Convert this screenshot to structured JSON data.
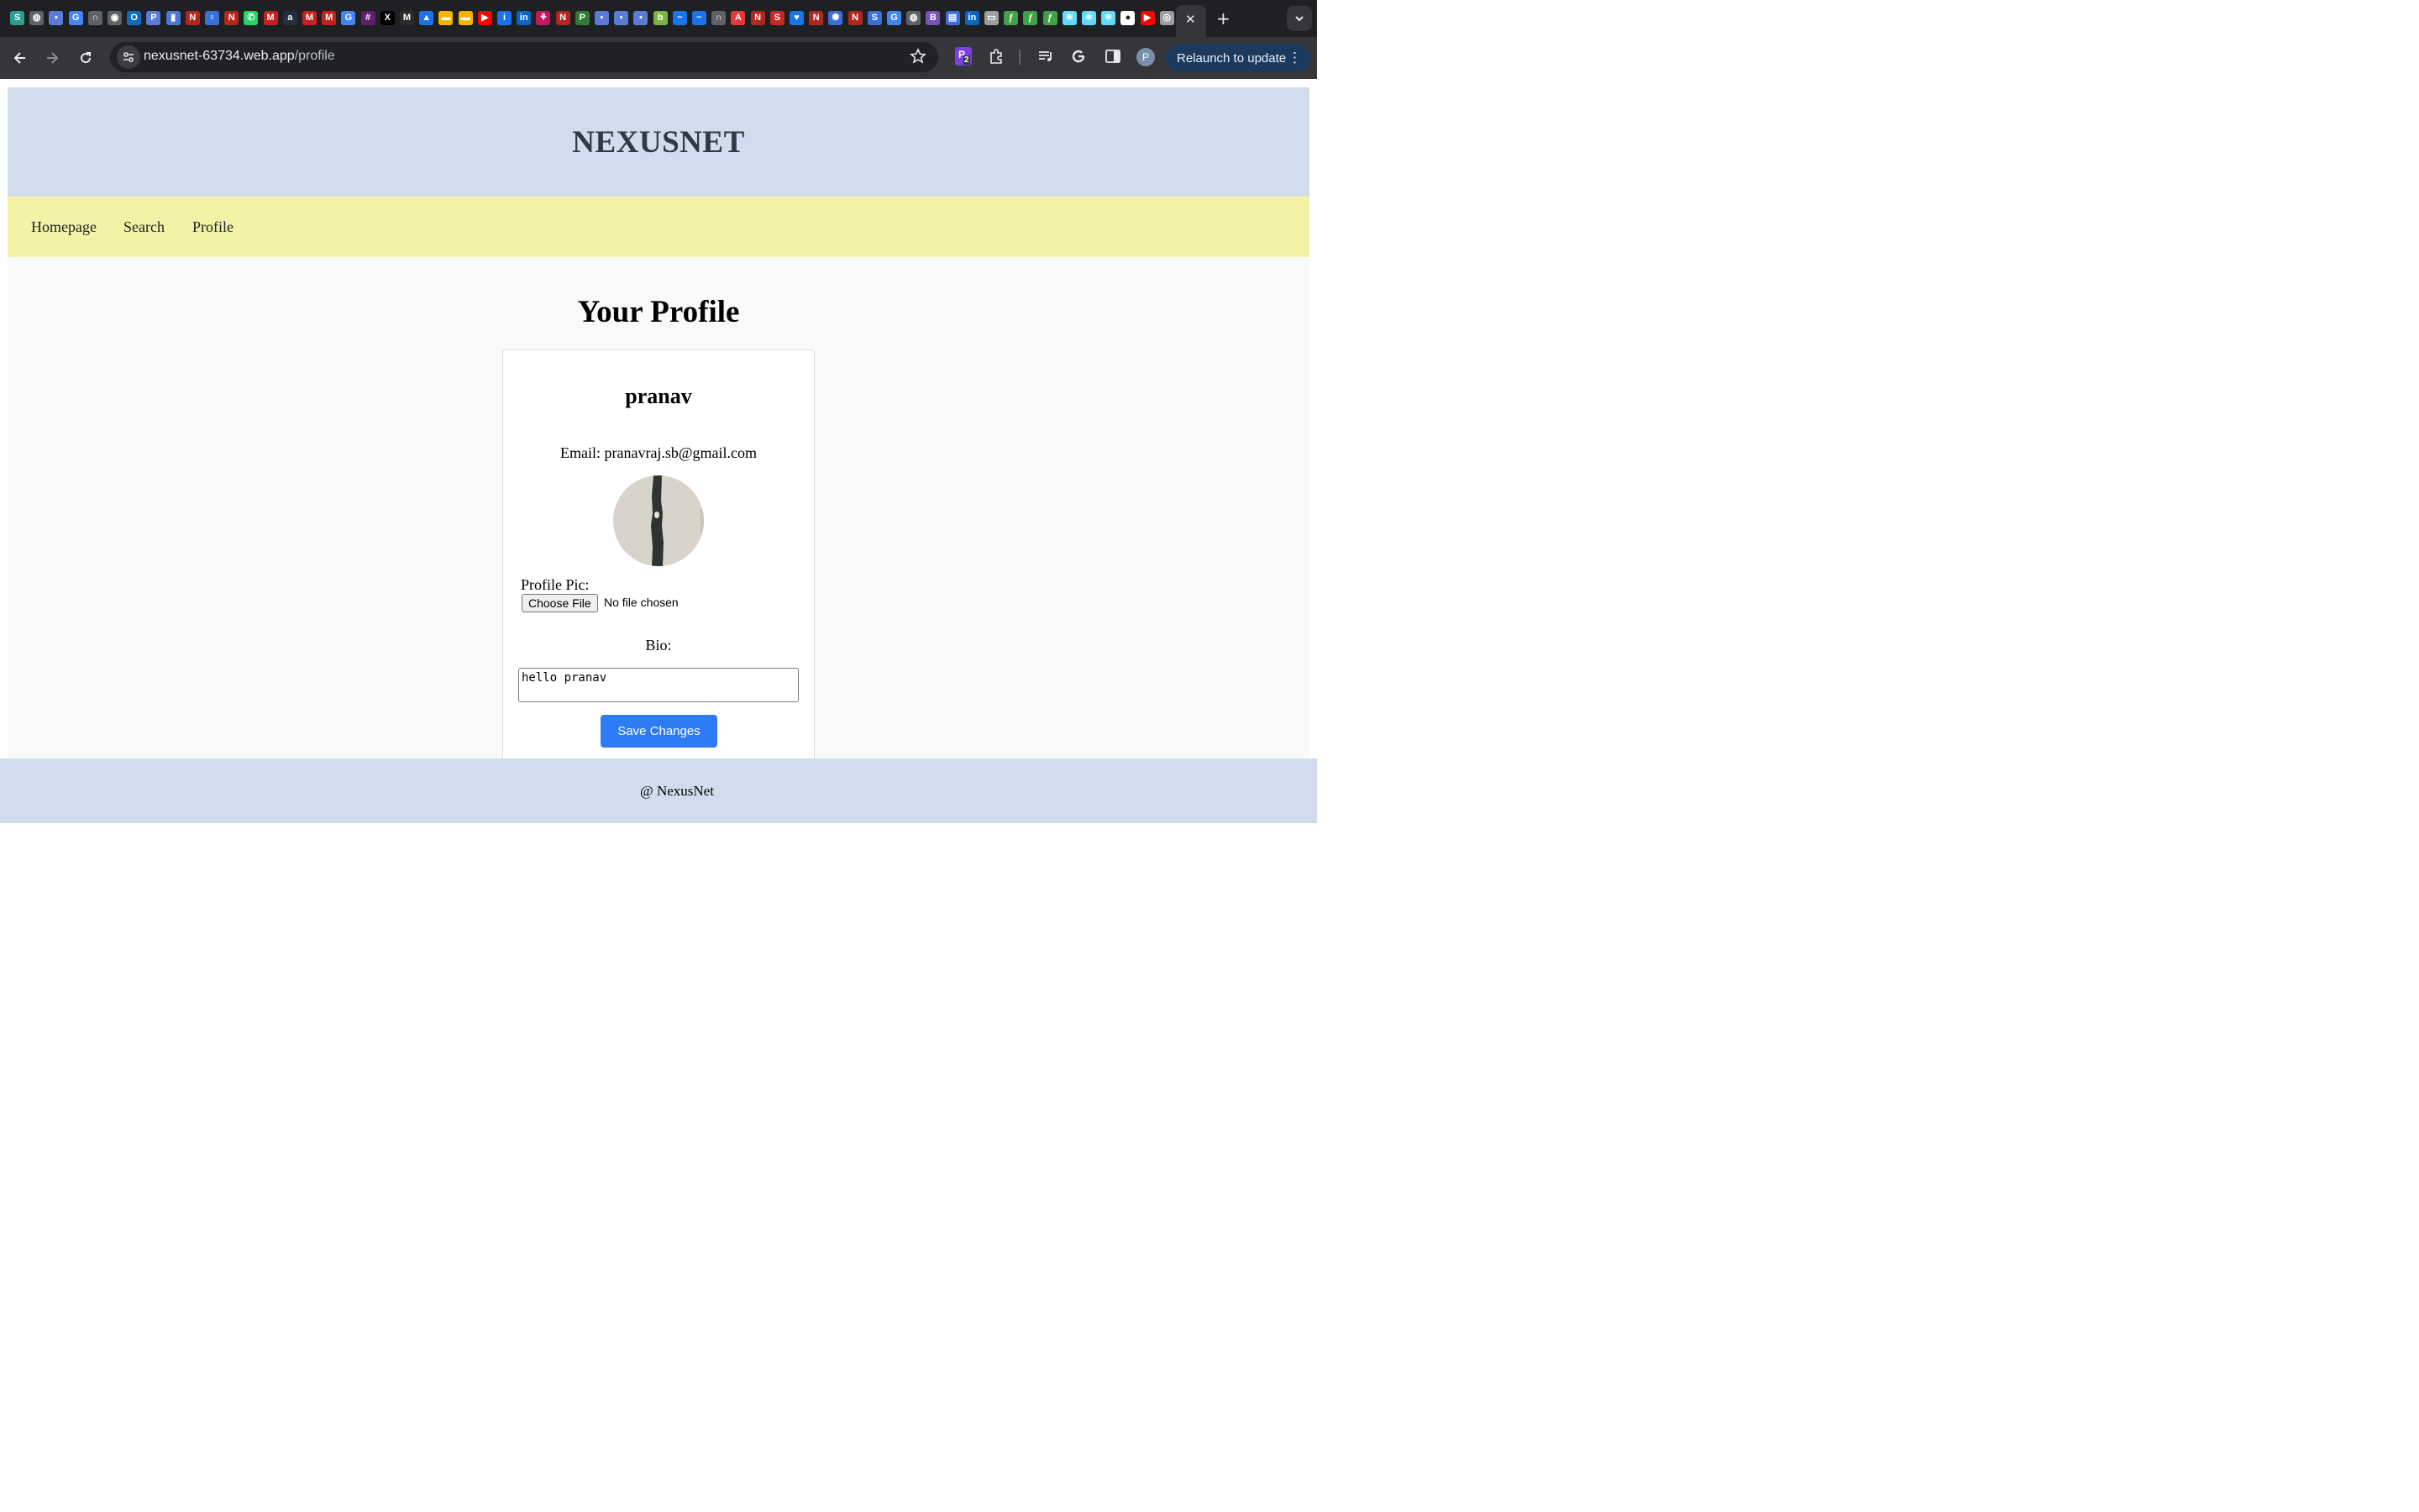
{
  "browser": {
    "tabs_active_close": "✕",
    "new_tab": "+",
    "url_host": "nexusnet-63734.web.app",
    "url_path": "/profile",
    "extension_badge": "2",
    "profile_initial": "P",
    "relaunch_label": "Relaunch to update",
    "favicons": [
      {
        "icon": "s-icon",
        "color": "#2a9d8f",
        "glyph": "S"
      },
      {
        "icon": "globe-icon",
        "color": "#5f6368",
        "glyph": "◍"
      },
      {
        "icon": "square-icon",
        "color": "#5b7bd5",
        "glyph": "▪"
      },
      {
        "icon": "google-icon",
        "color": "#4285f4",
        "glyph": "G"
      },
      {
        "icon": "headphones-icon",
        "color": "#5f6368",
        "glyph": "∩"
      },
      {
        "icon": "record-icon",
        "color": "#5f6368",
        "glyph": "◉"
      },
      {
        "icon": "outlook-icon",
        "color": "#0f6cbd",
        "glyph": "O"
      },
      {
        "icon": "p-icon",
        "color": "#5b7bd5",
        "glyph": "P"
      },
      {
        "icon": "bars-icon",
        "color": "#4a78d8",
        "glyph": "▮"
      },
      {
        "icon": "n-icon",
        "color": "#b3261e",
        "glyph": "N"
      },
      {
        "icon": "bulb-icon",
        "color": "#3b6fd8",
        "glyph": "♀"
      },
      {
        "icon": "n-icon",
        "color": "#b3261e",
        "glyph": "N"
      },
      {
        "icon": "whatsapp-icon",
        "color": "#25d366",
        "glyph": "✆"
      },
      {
        "icon": "gmail-icon",
        "color": "#c5221f",
        "glyph": "M"
      },
      {
        "icon": "amazon-icon",
        "color": "#232f3e",
        "glyph": "a"
      },
      {
        "icon": "gmail-icon",
        "color": "#c5221f",
        "glyph": "M"
      },
      {
        "icon": "gmail-icon",
        "color": "#c5221f",
        "glyph": "M"
      },
      {
        "icon": "google-icon",
        "color": "#4285f4",
        "glyph": "G"
      },
      {
        "icon": "slack-icon",
        "color": "#611f69",
        "glyph": "#"
      },
      {
        "icon": "x-icon",
        "color": "#000000",
        "glyph": "X"
      },
      {
        "icon": "m-icon",
        "color": "#2b2b2b",
        "glyph": "M"
      },
      {
        "icon": "drive-icon",
        "color": "#1a73e8",
        "glyph": "▲"
      },
      {
        "icon": "slides-icon",
        "color": "#f4b400",
        "glyph": "▬"
      },
      {
        "icon": "slides-icon",
        "color": "#f4b400",
        "glyph": "▬"
      },
      {
        "icon": "youtube-icon",
        "color": "#ff0000",
        "glyph": "▶"
      },
      {
        "icon": "info-icon",
        "color": "#1a73e8",
        "glyph": "i"
      },
      {
        "icon": "linkedin-icon",
        "color": "#0a66c2",
        "glyph": "in"
      },
      {
        "icon": "flower-icon",
        "color": "#c2185b",
        "glyph": "⚘"
      },
      {
        "icon": "n-icon",
        "color": "#b3261e",
        "glyph": "N"
      },
      {
        "icon": "p-icon",
        "color": "#2e7d32",
        "glyph": "P"
      },
      {
        "icon": "square-icon",
        "color": "#5b7bd5",
        "glyph": "▪"
      },
      {
        "icon": "square-icon",
        "color": "#5b7bd5",
        "glyph": "▪"
      },
      {
        "icon": "square-icon",
        "color": "#5b7bd5",
        "glyph": "▪"
      },
      {
        "icon": "leaf-icon",
        "color": "#7cb342",
        "glyph": "b"
      },
      {
        "icon": "wave-icon",
        "color": "#1a73e8",
        "glyph": "~"
      },
      {
        "icon": "wave-icon",
        "color": "#1a73e8",
        "glyph": "~"
      },
      {
        "icon": "headphones-icon",
        "color": "#5f6368",
        "glyph": "∩"
      },
      {
        "icon": "adobe-icon",
        "color": "#e53935",
        "glyph": "A"
      },
      {
        "icon": "n-icon",
        "color": "#b3261e",
        "glyph": "N"
      },
      {
        "icon": "s-icon",
        "color": "#c62828",
        "glyph": "S"
      },
      {
        "icon": "heart-icon",
        "color": "#1a73e8",
        "glyph": "♥"
      },
      {
        "icon": "n-icon",
        "color": "#b3261e",
        "glyph": "N"
      },
      {
        "icon": "sun-icon",
        "color": "#3b6fd8",
        "glyph": "✺"
      },
      {
        "icon": "n-icon",
        "color": "#b3261e",
        "glyph": "N"
      },
      {
        "icon": "s-icon",
        "color": "#3b6fd8",
        "glyph": "S"
      },
      {
        "icon": "google-icon",
        "color": "#4285f4",
        "glyph": "G"
      },
      {
        "icon": "globe-icon",
        "color": "#5f6368",
        "glyph": "◍"
      },
      {
        "icon": "bootstrap-icon",
        "color": "#7952b3",
        "glyph": "B"
      },
      {
        "icon": "sheet-icon",
        "color": "#3b6fd8",
        "glyph": "▤"
      },
      {
        "icon": "linkedin-icon",
        "color": "#0a66c2",
        "glyph": "in"
      },
      {
        "icon": "card-icon",
        "color": "#9e9e9e",
        "glyph": "▭"
      },
      {
        "icon": "feather-icon",
        "color": "#43a047",
        "glyph": "ƒ"
      },
      {
        "icon": "feather-icon",
        "color": "#43a047",
        "glyph": "ƒ"
      },
      {
        "icon": "feather-icon",
        "color": "#43a047",
        "glyph": "ƒ"
      },
      {
        "icon": "react-icon",
        "color": "#61dafb",
        "glyph": "⚛"
      },
      {
        "icon": "react-icon",
        "color": "#61dafb",
        "glyph": "⚛"
      },
      {
        "icon": "react-icon",
        "color": "#61dafb",
        "glyph": "⚛"
      },
      {
        "icon": "github-icon",
        "color": "#ffffff",
        "glyph": "●"
      },
      {
        "icon": "youtube-icon",
        "color": "#ff0000",
        "glyph": "▶"
      },
      {
        "icon": "chrome-icon",
        "color": "#9e9e9e",
        "glyph": "◎"
      }
    ]
  },
  "site": {
    "title": "NEXUSNET",
    "nav": [
      "Homepage",
      "Search",
      "Profile"
    ]
  },
  "profile": {
    "heading": "Your Profile",
    "username": "pranav",
    "email_line": "Email: pranavraj.sb@gmail.com",
    "pic_label": "Profile Pic:",
    "file_button": "Choose File",
    "file_status": "No file chosen",
    "bio_label": "Bio:",
    "bio_value": "hello pranav",
    "save_label": "Save Changes"
  },
  "footer": {
    "text": "@ NexusNet"
  },
  "colors": {
    "header_bg": "#d1ddec",
    "nav_bg": "#f4f2a6",
    "main_bg": "#f8f9fa",
    "save_button": "#2d7cf6"
  }
}
